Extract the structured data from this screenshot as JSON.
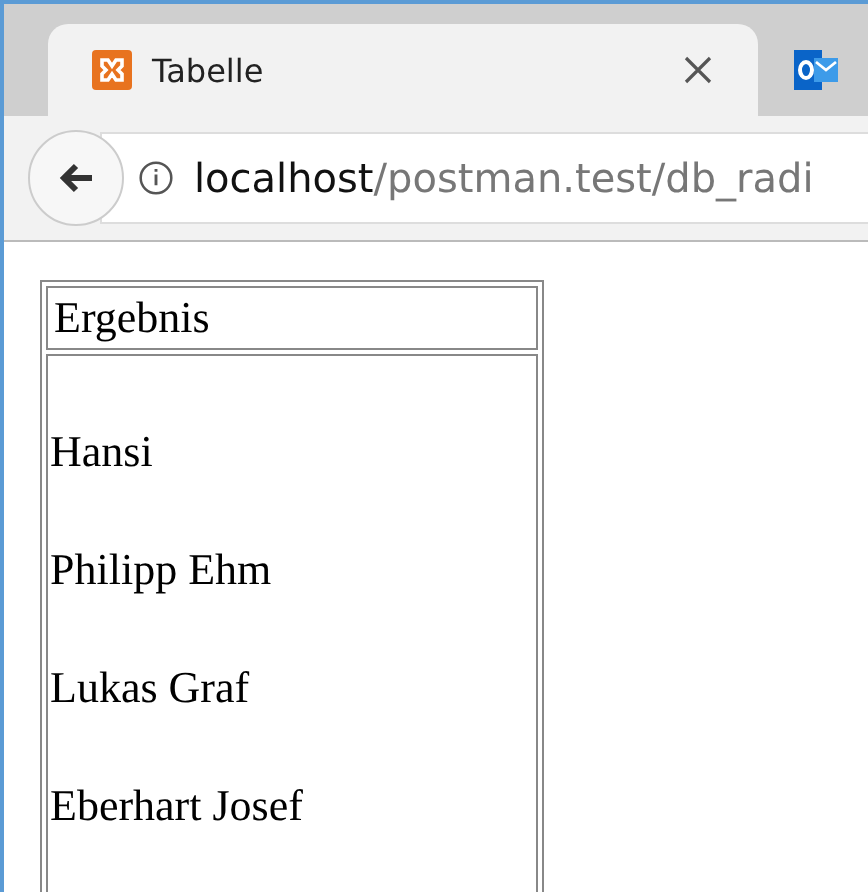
{
  "tab": {
    "title": "Tabelle"
  },
  "address": {
    "host": "localhost",
    "path": "/postman.test/db_radi"
  },
  "table": {
    "header": "Ergebnis",
    "rows": [
      "Hansi",
      "Philipp Ehm",
      "Lukas Graf",
      "Eberhart Josef"
    ]
  }
}
